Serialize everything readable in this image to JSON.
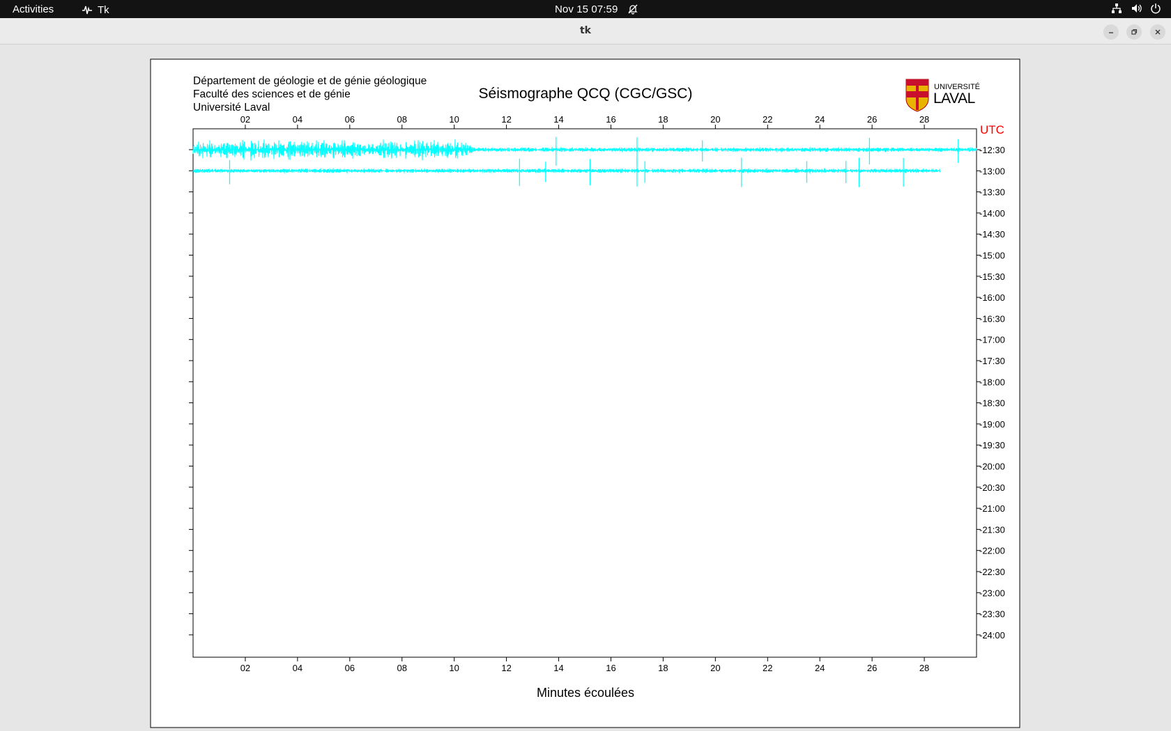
{
  "topbar": {
    "activities": "Activities",
    "app_name": "Tk",
    "clock": "Nov 15  07:59"
  },
  "window": {
    "title": "tk"
  },
  "header": {
    "line1": "Département de géologie et de génie géologique",
    "line2": "Faculté des sciences et de génie",
    "line3": "Université Laval",
    "logo_text_top": "UNIVERSITÉ",
    "logo_text_bottom": "LAVAL"
  },
  "chart_data": {
    "type": "line",
    "title": "Séismographe QCQ (CGC/GSC)",
    "xlabel": "Minutes écoulées",
    "ylabel": "UTC",
    "xlim": [
      0,
      30
    ],
    "x_ticks": [
      "02",
      "04",
      "06",
      "08",
      "10",
      "12",
      "14",
      "16",
      "18",
      "20",
      "22",
      "24",
      "26",
      "28"
    ],
    "y_ticks": [
      "12:30",
      "13:00",
      "13:30",
      "14:00",
      "14:30",
      "15:00",
      "15:30",
      "16:00",
      "16:30",
      "17:00",
      "17:30",
      "18:00",
      "18:30",
      "19:00",
      "19:30",
      "20:00",
      "20:30",
      "21:00",
      "21:30",
      "22:00",
      "22:30",
      "23:00",
      "23:30",
      "24:00"
    ],
    "trace_color": "#00ffff",
    "utc_color": "#ff0000",
    "series": [
      {
        "row": "12:30",
        "x_end": 30,
        "noisy_until": 10.7,
        "spikes": [
          13.9,
          17.0,
          19.5,
          25.9,
          29.3
        ]
      },
      {
        "row": "13:00",
        "x_end": 28.6,
        "noisy_until": 0,
        "spikes": [
          1.4,
          12.5,
          13.5,
          15.2,
          17.0,
          17.3,
          21.0,
          23.5,
          25.0,
          25.5,
          27.2
        ]
      }
    ]
  }
}
